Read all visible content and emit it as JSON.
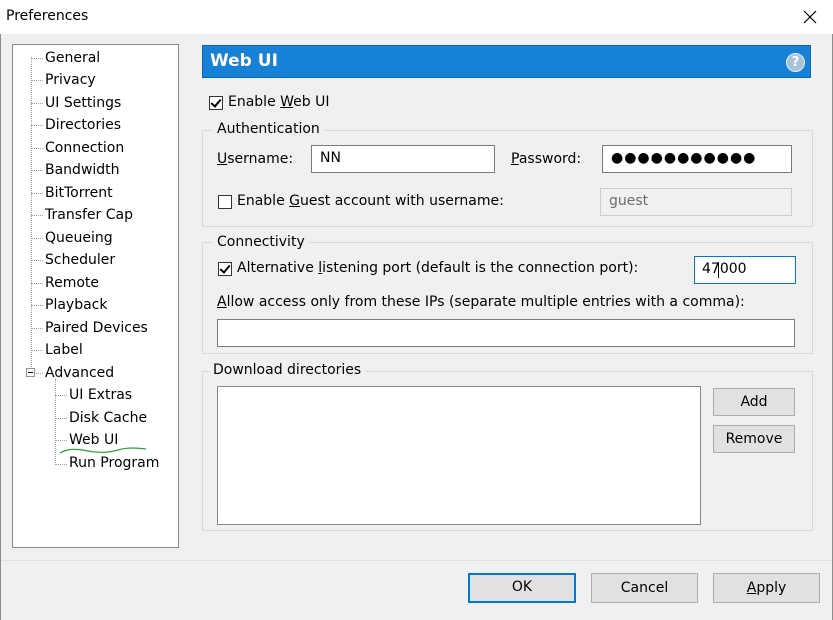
{
  "window": {
    "title": "Preferences"
  },
  "tree": {
    "items": [
      {
        "label": "General"
      },
      {
        "label": "Privacy"
      },
      {
        "label": "UI Settings"
      },
      {
        "label": "Directories"
      },
      {
        "label": "Connection"
      },
      {
        "label": "Bandwidth"
      },
      {
        "label": "BitTorrent"
      },
      {
        "label": "Transfer Cap"
      },
      {
        "label": "Queueing"
      },
      {
        "label": "Scheduler"
      },
      {
        "label": "Remote"
      },
      {
        "label": "Playback"
      },
      {
        "label": "Paired Devices"
      },
      {
        "label": "Label"
      },
      {
        "label": "Advanced"
      }
    ],
    "children": [
      {
        "label": "UI Extras"
      },
      {
        "label": "Disk Cache"
      },
      {
        "label": "Web UI"
      },
      {
        "label": "Run Program"
      }
    ],
    "selected": "Web UI"
  },
  "header": {
    "title": "Web UI",
    "help_glyph": "?"
  },
  "enable_webui": {
    "label_pre": "Enable ",
    "label_accel": "W",
    "label_post": "eb UI",
    "checked": true
  },
  "authentication": {
    "title": "Authentication",
    "username_label_accel": "U",
    "username_label_rest": "sername:",
    "username_value": "NN",
    "password_label_accel": "P",
    "password_label_rest": "assword:",
    "password_mask": "●●●●●●●●●●●",
    "guest_label_pre": "Enable ",
    "guest_label_accel": "G",
    "guest_label_post": "uest account with username:",
    "guest_checked": false,
    "guest_value": "guest"
  },
  "connectivity": {
    "title": "Connectivity",
    "alt_port_label_pre": "Alternative ",
    "alt_port_label_accel": "l",
    "alt_port_label_post": "istening port (default is the connection port):",
    "alt_port_checked": true,
    "port_value": "47000",
    "allow_label_accel": "A",
    "allow_label_rest": "llow access only from these IPs (separate multiple entries with a comma):",
    "allow_value": ""
  },
  "download_dirs": {
    "title": "Download directories",
    "add_label": "Add",
    "remove_label": "Remove"
  },
  "buttons": {
    "ok": "OK",
    "cancel": "Cancel",
    "apply_accel": "A",
    "apply_rest": "pply"
  },
  "colors": {
    "header_bg": "#1681d5",
    "default_button_border": "#0078d7",
    "annotation": "#2e9f3a"
  },
  "icons": {
    "close": "close-icon",
    "help": "help-icon",
    "expander": "collapse-icon"
  }
}
